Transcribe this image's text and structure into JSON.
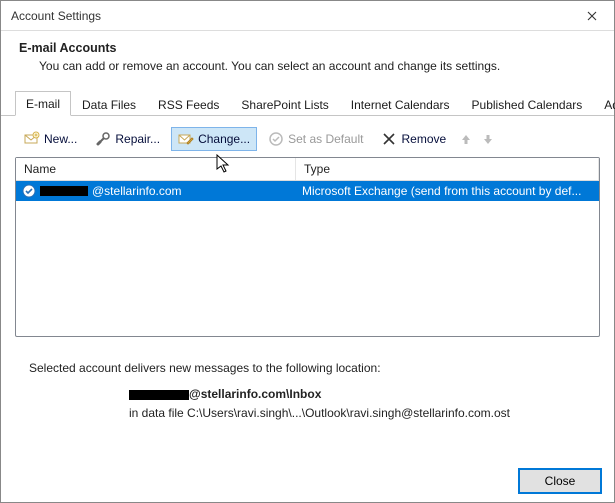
{
  "titlebar": {
    "title": "Account Settings"
  },
  "header": {
    "title": "E-mail Accounts",
    "description": "You can add or remove an account. You can select an account and change its settings."
  },
  "tabs": [
    {
      "label": "E-mail",
      "active": true
    },
    {
      "label": "Data Files"
    },
    {
      "label": "RSS Feeds"
    },
    {
      "label": "SharePoint Lists"
    },
    {
      "label": "Internet Calendars"
    },
    {
      "label": "Published Calendars"
    },
    {
      "label": "Address Books"
    }
  ],
  "toolbar": {
    "new_label": "New...",
    "repair_label": "Repair...",
    "change_label": "Change...",
    "set_default_label": "Set as Default",
    "remove_label": "Remove"
  },
  "list": {
    "columns": {
      "name": "Name",
      "type": "Type"
    },
    "rows": [
      {
        "email_suffix": "@stellarinfo.com",
        "type": "Microsoft Exchange (send from this account by def..."
      }
    ]
  },
  "lower": {
    "line1": "Selected account delivers new messages to the following location:",
    "location_suffix": "@stellarinfo.com\\Inbox",
    "datafile_line": "in data file C:\\Users\\ravi.singh\\...\\Outlook\\ravi.singh@stellarinfo.com.ost"
  },
  "footer": {
    "close_label": "Close"
  }
}
